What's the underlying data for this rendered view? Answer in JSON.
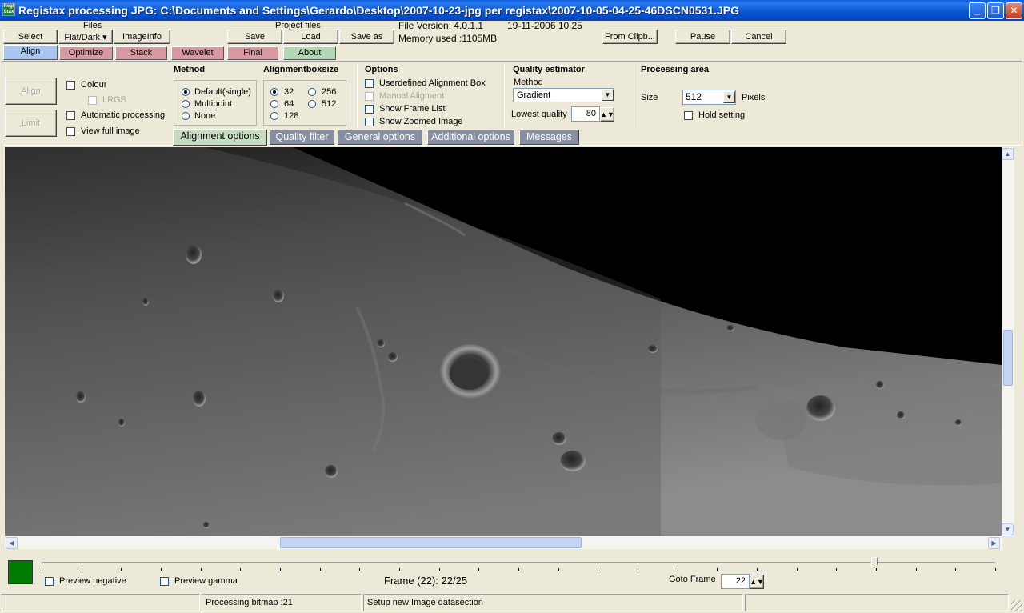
{
  "window": {
    "title": "Registax processing JPG: C:\\Documents and Settings\\Gerardo\\Desktop\\2007-10-23-jpg per registax\\2007-10-05-04-25-46DSCN0531.JPG",
    "icon_text": "Regi\nStax",
    "minimize_glyph": "_",
    "maximize_glyph": "❐",
    "close_glyph": "✕"
  },
  "toolbar": {
    "files_label": "Files",
    "select": "Select",
    "flatdark": "Flat/Dark ▾",
    "imageinfo": "ImageInfo",
    "project_files_label": "Project files",
    "save": "Save",
    "load": "Load",
    "save_as": "Save as",
    "file_version": "File Version: 4.0.1.1",
    "file_date": "19-11-2006 10.25",
    "memory_used": "Memory used :1105MB",
    "from_clipboard": "From Clipb...",
    "pause": "Pause",
    "cancel": "Cancel"
  },
  "tabs": [
    {
      "label": "Align",
      "color": "#a9c6f0",
      "active": true
    },
    {
      "label": "Optimize",
      "color": "#d89aa0"
    },
    {
      "label": "Stack",
      "color": "#d89aa0"
    },
    {
      "label": "Wavelet",
      "color": "#d89aa0"
    },
    {
      "label": "Final",
      "color": "#d89aa0"
    },
    {
      "label": "About",
      "color": "#b4d8b4"
    }
  ],
  "align_panel": {
    "align_button": "Align",
    "limit_button": "Limit",
    "colour": "Colour",
    "lrgb": "LRGB",
    "automatic_processing": "Automatic processing",
    "view_full_image": "View full image",
    "method_title": "Method",
    "method_options": [
      "Default(single)",
      "Multipoint",
      "None"
    ],
    "boxsize_title": "Alignmentboxsize",
    "boxsize_options": [
      "32",
      "256",
      "64",
      "512",
      "128"
    ],
    "options_title": "Options",
    "options": [
      "Userdefined Alignment Box",
      "Manual Aligment",
      "Show Frame List",
      "Show Zoomed Image"
    ],
    "quality_title": "Quality estimator",
    "quality_method_label": "Method",
    "quality_method_value": "Gradient",
    "lowest_quality_label": "Lowest quality",
    "lowest_quality_value": "80",
    "processing_title": "Processing area",
    "size_label": "Size",
    "size_value": "512",
    "pixels_label": "Pixels",
    "hold_setting": "Hold setting"
  },
  "subtabs": [
    {
      "label": "Alignment  options",
      "active": true
    },
    {
      "label": "Quality  filter"
    },
    {
      "label": "General options"
    },
    {
      "label": "Additional options"
    },
    {
      "label": "Messages"
    }
  ],
  "bottom": {
    "preview_negative": "Preview negative",
    "preview_gamma": "Preview gamma",
    "frame_info": "Frame (22): 22/25",
    "goto_frame_label": "Goto Frame",
    "goto_frame_value": "22",
    "frame_slider_position": 0.873,
    "indicator_color": "#007a00"
  },
  "status": {
    "pane1": "",
    "pane2": "Processing bitmap :21",
    "pane3": "Setup new Image datasection",
    "pane4": ""
  }
}
